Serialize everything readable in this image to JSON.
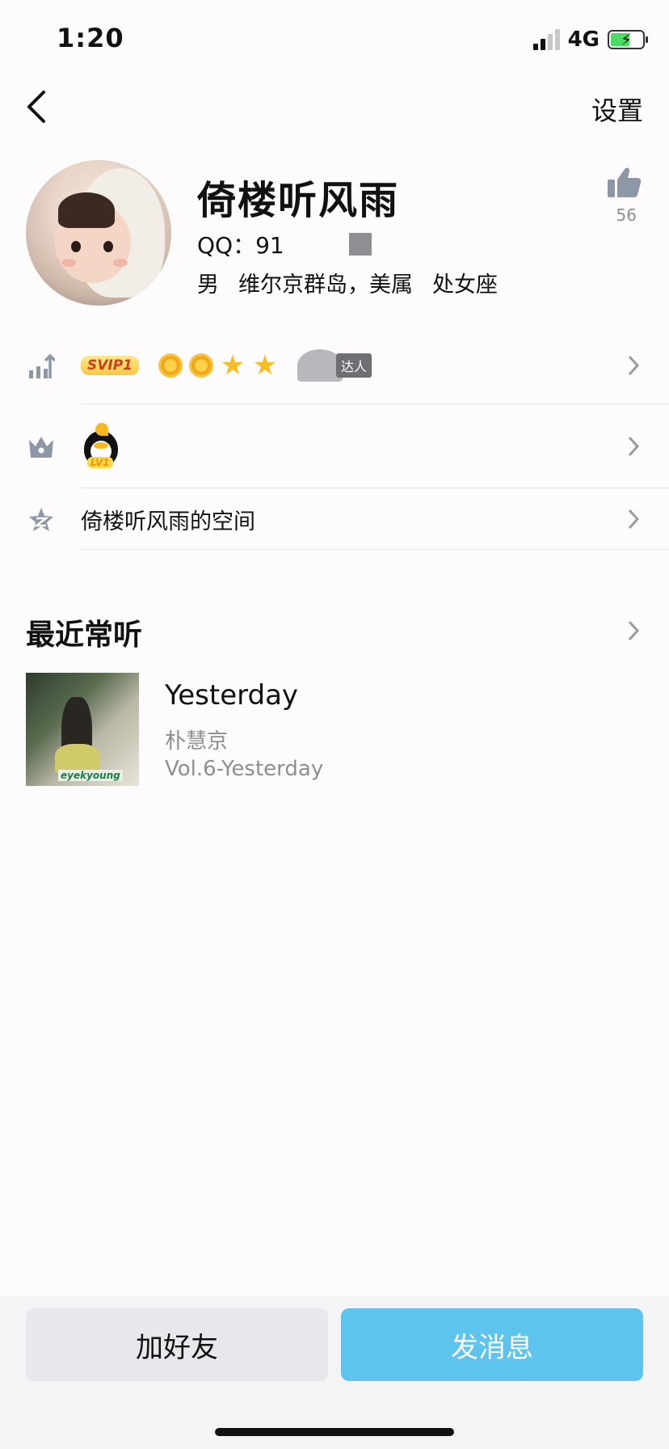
{
  "status_bar": {
    "time": "1:20",
    "network": "4G",
    "battery_level": 0.6
  },
  "nav": {
    "settings_label": "设置"
  },
  "profile": {
    "name": "倚楼听风雨",
    "qq_label": "QQ：91",
    "gender": "男",
    "location": "维尔京群岛，美属",
    "zodiac": "处女座",
    "like_count": "56"
  },
  "badges_row": {
    "svip_label": "SVIP1",
    "talent_label": "达人"
  },
  "level_row": {
    "level_label": "LV1"
  },
  "space_row": {
    "label": "倚楼听风雨的空间"
  },
  "recent": {
    "title": "最近常听",
    "song": {
      "title": "Yesterday",
      "artist": "朴慧京",
      "album": "Vol.6-Yesterday",
      "cover_text": "eyekyoung"
    }
  },
  "actions": {
    "add_friend": "加好友",
    "send_message": "发消息"
  },
  "colors": {
    "primary_button": "#5ec4ee",
    "secondary_button": "#e7e8ec",
    "muted_text": "#8e8e93"
  }
}
